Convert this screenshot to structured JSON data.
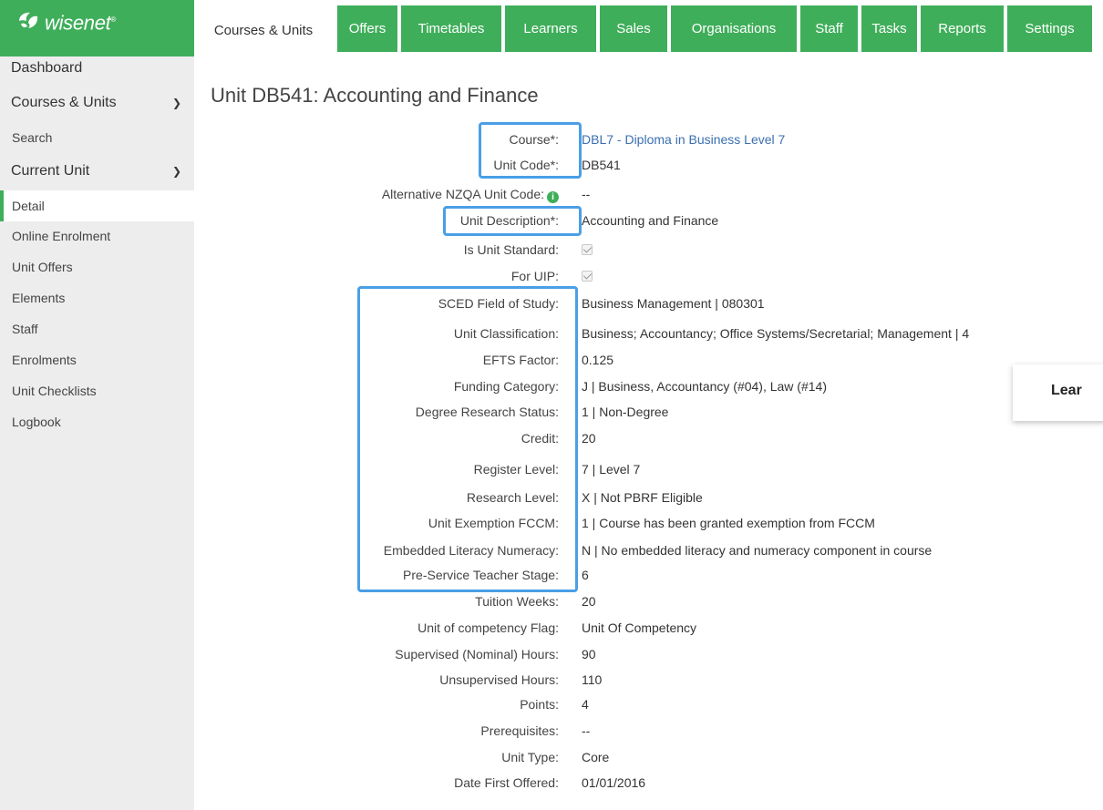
{
  "brand": {
    "name": "wisenet",
    "trademark": "®",
    "color": "#3fae5a"
  },
  "nav": {
    "tabs": [
      {
        "label": "Courses & Units",
        "active": true
      },
      {
        "label": "Offers"
      },
      {
        "label": "Timetables"
      },
      {
        "label": "Learners"
      },
      {
        "label": "Sales"
      },
      {
        "label": "Organisations"
      },
      {
        "label": "Staff"
      },
      {
        "label": "Tasks"
      },
      {
        "label": "Reports"
      },
      {
        "label": "Settings"
      }
    ]
  },
  "sidebar": {
    "dashboard": "Dashboard",
    "courses_units": "Courses & Units",
    "search": "Search",
    "current_unit": "Current Unit",
    "items": [
      {
        "label": "Detail",
        "active": true
      },
      {
        "label": "Online Enrolment"
      },
      {
        "label": "Unit Offers"
      },
      {
        "label": "Elements"
      },
      {
        "label": "Staff"
      },
      {
        "label": "Enrolments"
      },
      {
        "label": "Unit Checklists"
      },
      {
        "label": "Logbook"
      }
    ]
  },
  "page": {
    "title": "Unit DB541: Accounting and Finance"
  },
  "fields": [
    {
      "label": "Course*:",
      "value": "DBL7 - Diploma in Business Level 7"
    },
    {
      "label": "Unit Code*:",
      "value": "DB541"
    },
    {
      "label": "Alternative NZQA Unit Code:",
      "value": "--",
      "info_icon": "i"
    },
    {
      "label": "Unit Description*:",
      "value": "Accounting and Finance"
    },
    {
      "label": "Is Unit Standard:",
      "checked": true
    },
    {
      "label": "For UIP:",
      "checked": true
    },
    {
      "label": "SCED Field of Study:",
      "value": "Business Management | 080301"
    },
    {
      "label": "Unit Classification:",
      "value": "Business; Accountancy; Office Systems/Secretarial; Management | 4"
    },
    {
      "label": "EFTS Factor:",
      "value": "0.125"
    },
    {
      "label": "Funding Category:",
      "value": "J | Business, Accountancy (#04), Law (#14)"
    },
    {
      "label": "Degree Research Status:",
      "value": "1 | Non-Degree"
    },
    {
      "label": "Credit:",
      "value": "20"
    },
    {
      "label": "Register Level:",
      "value": "7 | Level 7"
    },
    {
      "label": "Research Level:",
      "value": "X | Not PBRF Eligible"
    },
    {
      "label": "Unit Exemption FCCM:",
      "value": "1 | Course has been granted exemption from FCCM"
    },
    {
      "label": "Embedded Literacy Numeracy:",
      "value": "N | No embedded literacy and numeracy component in course"
    },
    {
      "label": "Pre-Service Teacher Stage:",
      "value": "6"
    },
    {
      "label": "Tuition Weeks:",
      "value": "20"
    },
    {
      "label": "Unit of competency Flag:",
      "value": "Unit Of Competency"
    },
    {
      "label": "Supervised (Nominal) Hours:",
      "value": "90"
    },
    {
      "label": "Unsupervised Hours:",
      "value": "110"
    },
    {
      "label": "Points:",
      "value": "4"
    },
    {
      "label": "Prerequisites:",
      "value": "--"
    },
    {
      "label": "Unit Type:",
      "value": "Core"
    },
    {
      "label": "Date First Offered:",
      "value": "01/01/2016"
    }
  ],
  "floating_panel": {
    "label": "Lear"
  },
  "highlight_color": "#4a9fe6"
}
